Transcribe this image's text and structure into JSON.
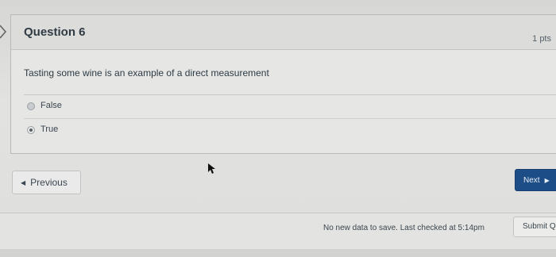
{
  "question": {
    "title": "Question 6",
    "points": "1 pts",
    "text": "Tasting some wine is an example of a direct measurement",
    "answers": [
      {
        "label": "False",
        "selected": false
      },
      {
        "label": "True",
        "selected": true
      }
    ]
  },
  "navigation": {
    "previous_label": "Previous",
    "next_label": "Next",
    "previous_icon": "triangle-left-icon",
    "next_icon": "triangle-right-icon"
  },
  "footer": {
    "status": "No new data to save. Last checked at 5:14pm",
    "submit_label": "Submit Q"
  },
  "colors": {
    "next_button": "#1d4d87"
  }
}
